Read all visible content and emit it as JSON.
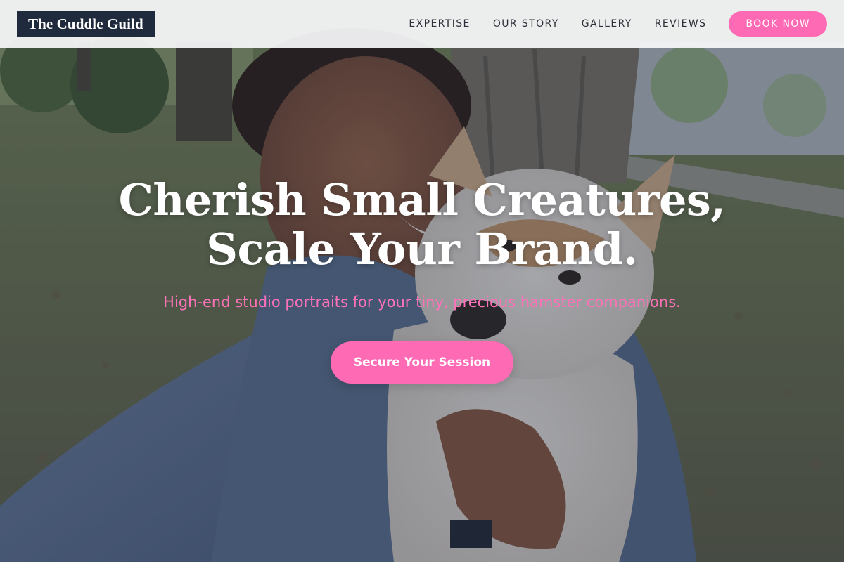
{
  "header": {
    "logo": "The Cuddle Guild",
    "nav": [
      {
        "label": "EXPERTISE"
      },
      {
        "label": "OUR STORY"
      },
      {
        "label": "GALLERY"
      },
      {
        "label": "REVIEWS"
      }
    ],
    "cta": "BOOK NOW"
  },
  "hero": {
    "title_line1": "Cherish Small Creatures,",
    "title_line2": "Scale Your Brand.",
    "subtitle": "High-end studio portraits for your tiny, precious hamster companions.",
    "cta": "Secure Your Session"
  },
  "colors": {
    "accent": "#ff6ab4",
    "logo_bg": "#1f2a3c",
    "subtitle": "#ff72b9"
  }
}
